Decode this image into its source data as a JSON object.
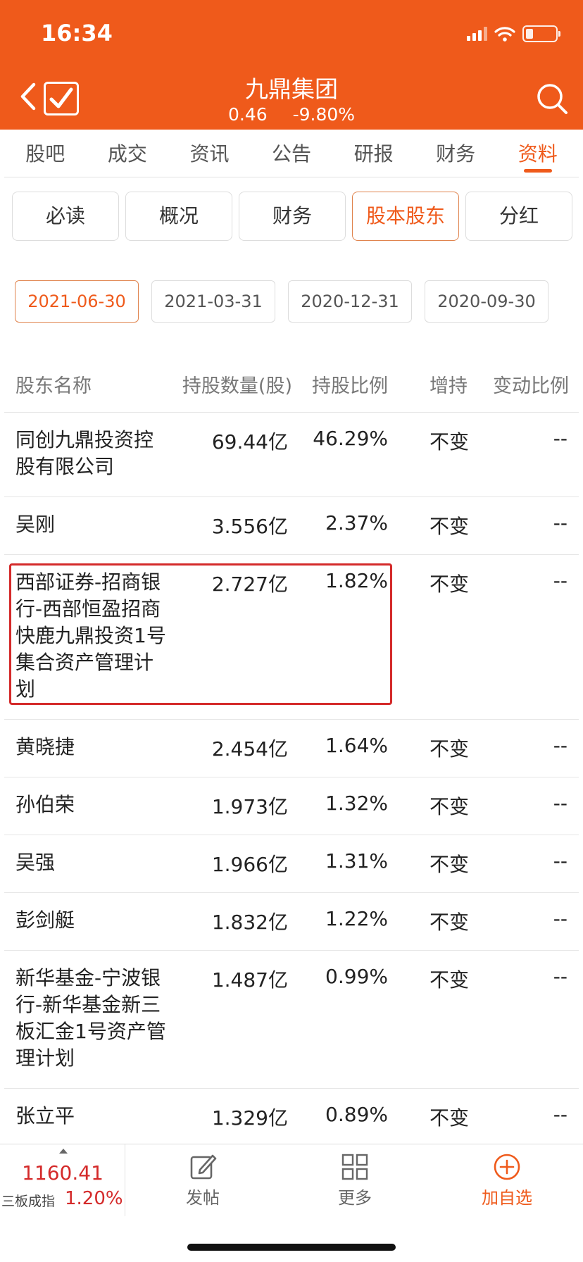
{
  "status_bar": {
    "time": "16:34"
  },
  "header": {
    "title": "九鼎集团",
    "price": "0.46",
    "change": "-9.80%"
  },
  "tabs": [
    {
      "label": "股吧"
    },
    {
      "label": "成交"
    },
    {
      "label": "资讯"
    },
    {
      "label": "公告"
    },
    {
      "label": "研报"
    },
    {
      "label": "财务"
    },
    {
      "label": "资料",
      "active": true
    }
  ],
  "segments": [
    {
      "label": "必读"
    },
    {
      "label": "概况"
    },
    {
      "label": "财务"
    },
    {
      "label": "股本股东",
      "active": true
    },
    {
      "label": "分红"
    }
  ],
  "dates": [
    {
      "label": "2021-06-30",
      "active": true
    },
    {
      "label": "2021-03-31"
    },
    {
      "label": "2020-12-31"
    },
    {
      "label": "2020-09-30"
    }
  ],
  "table": {
    "headers": {
      "name": "股东名称",
      "qty": "持股数量(股)",
      "pct": "持股比例",
      "change": "增持",
      "ratio": "变动比例"
    },
    "rows": [
      {
        "name": "同创九鼎投资控股有限公司",
        "qty": "69.44亿",
        "pct": "46.29%",
        "change": "不变",
        "ratio": "--"
      },
      {
        "name": "吴刚",
        "qty": "3.556亿",
        "pct": "2.37%",
        "change": "不变",
        "ratio": "--"
      },
      {
        "name": "西部证券-招商银行-西部恒盈招商快鹿九鼎投资1号集合资产管理计划",
        "qty": "2.727亿",
        "pct": "1.82%",
        "change": "不变",
        "ratio": "--"
      },
      {
        "name": "黄晓捷",
        "qty": "2.454亿",
        "pct": "1.64%",
        "change": "不变",
        "ratio": "--"
      },
      {
        "name": "孙伯荣",
        "qty": "1.973亿",
        "pct": "1.32%",
        "change": "不变",
        "ratio": "--"
      },
      {
        "name": "吴强",
        "qty": "1.966亿",
        "pct": "1.31%",
        "change": "不变",
        "ratio": "--"
      },
      {
        "name": "彭剑艇",
        "qty": "1.832亿",
        "pct": "1.22%",
        "change": "不变",
        "ratio": "--"
      },
      {
        "name": "新华基金-宁波银行-新华基金新三板汇金1号资产管理计划",
        "qty": "1.487亿",
        "pct": "0.99%",
        "change": "不变",
        "ratio": "--"
      },
      {
        "name": "张立平",
        "qty": "1.329亿",
        "pct": "0.89%",
        "change": "不变",
        "ratio": "--"
      }
    ]
  },
  "bottom_bar": {
    "index_value": "1160.41",
    "index_name": "三板成指",
    "index_change": "1.20%",
    "post_label": "发帖",
    "more_label": "更多",
    "watchlist_label": "加自选"
  },
  "colors": {
    "brand": "#ef5a1b",
    "highlight": "#d42a2a",
    "down": "#d42a2a"
  }
}
